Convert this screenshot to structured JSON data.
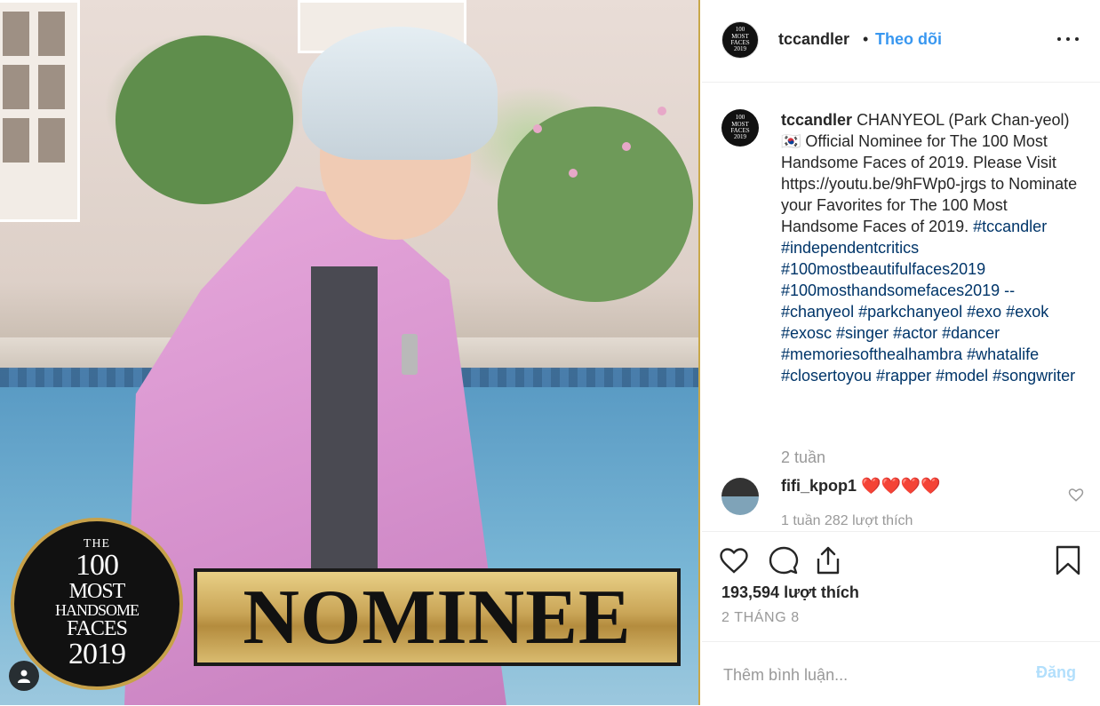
{
  "post": {
    "image": {
      "badge": {
        "line1": "THE",
        "line2": "100",
        "line3": "MOST",
        "line4": "HANDSOME",
        "line5": "FACES",
        "line6": "2019"
      },
      "nominee_text": "NOMINEE",
      "tag_icon": "person-icon"
    },
    "header": {
      "username": "tccandler",
      "dot": "•",
      "follow_label": "Theo dõi",
      "more_icon": "more-options-icon"
    },
    "caption": {
      "username": "tccandler",
      "text": "CHANYEOL (Park Chan-yeol) 🇰🇷 Official Nominee for The 100 Most Handsome Faces of 2019. Please Visit https://youtu.be/9hFWp0-jrgs to Nominate your Favorites for The 100 Most Handsome Faces of 2019.",
      "hashtags": "#tccandler #independentcritics #100mostbeautifulfaces2019 #100mosthandsomefaces2019 -- #chanyeol #parkchanyeol #exo #exok #exosc #singer #actor #dancer #memoriesofthealhambra #whatalife #closertoyou #rapper #model #songwriter",
      "time": "2 tuần"
    },
    "comment": {
      "username": "fifi_kpop1",
      "text": "❤️❤️❤️❤️",
      "meta": "1 tuần     282 lượt thích"
    },
    "actions": {
      "like_icon": "heart-icon",
      "comment_icon": "comment-icon",
      "share_icon": "share-icon",
      "save_icon": "bookmark-icon"
    },
    "likes": "193,594 lượt thích",
    "date": "2 THÁNG 8",
    "add_comment": {
      "placeholder": "Thêm bình luận...",
      "post_label": "Đăng"
    },
    "colors": {
      "accent": "#3897f0",
      "hashtag": "#003569",
      "muted": "#999999",
      "gold": "#c9a84a"
    }
  }
}
